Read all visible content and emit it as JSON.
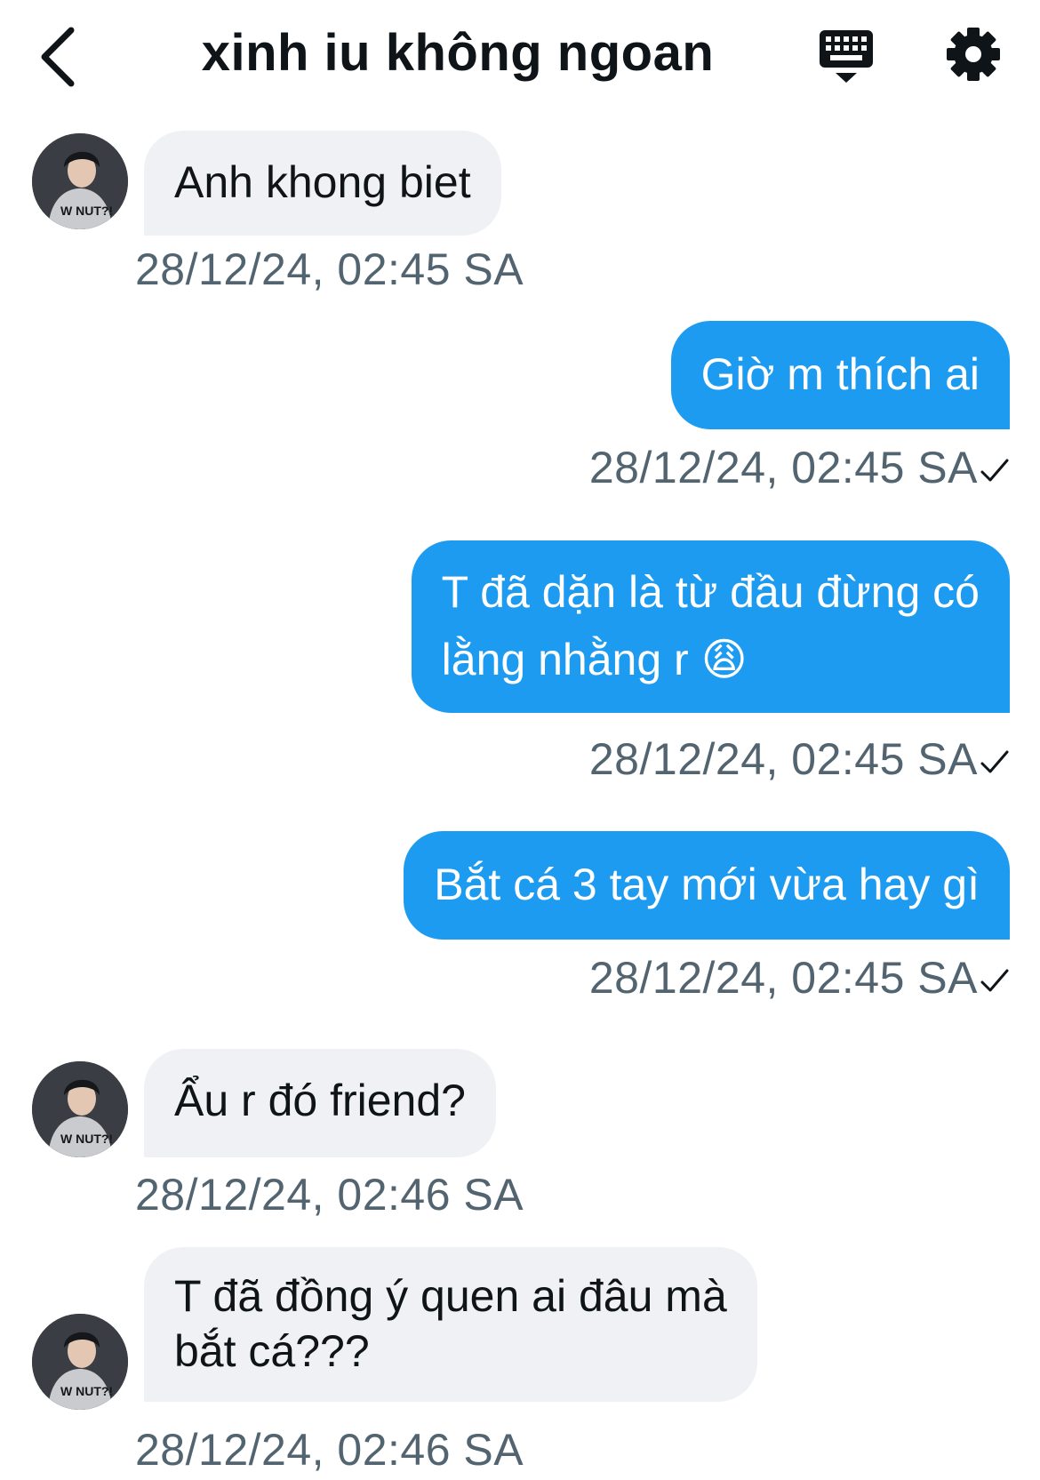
{
  "header": {
    "title": "xinh iu không ngoan",
    "back_icon": "chevron-left-icon",
    "keyboard_icon": "keyboard-icon",
    "settings_icon": "gear-icon"
  },
  "colors": {
    "outgoing_bubble": "#1d9bf0",
    "incoming_bubble": "#eff1f4",
    "timestamp": "#536471"
  },
  "messages": [
    {
      "direction": "incoming",
      "lines": [
        "Anh khong biet"
      ],
      "time": "28/12/24, 02:45 SA"
    },
    {
      "direction": "outgoing",
      "lines": [
        "Giờ m thích ai"
      ],
      "time": "28/12/24, 02:45 SA",
      "status": "sent-check-icon"
    },
    {
      "direction": "outgoing",
      "lines": [
        "T đã dặn là từ đầu đừng có",
        "lằng nhằng r 😩"
      ],
      "time": "28/12/24, 02:45 SA",
      "status": "sent-check-icon"
    },
    {
      "direction": "outgoing",
      "lines": [
        "Bắt cá 3 tay mới vừa hay gì"
      ],
      "time": "28/12/24, 02:45 SA",
      "status": "sent-check-icon"
    },
    {
      "direction": "incoming",
      "lines": [
        "Ẩu r đó friend?"
      ],
      "time": "28/12/24, 02:46 SA"
    },
    {
      "direction": "incoming",
      "lines": [
        "T đã đồng ý quen ai đâu mà",
        "bắt cá???"
      ],
      "time": "28/12/24, 02:46 SA"
    }
  ]
}
